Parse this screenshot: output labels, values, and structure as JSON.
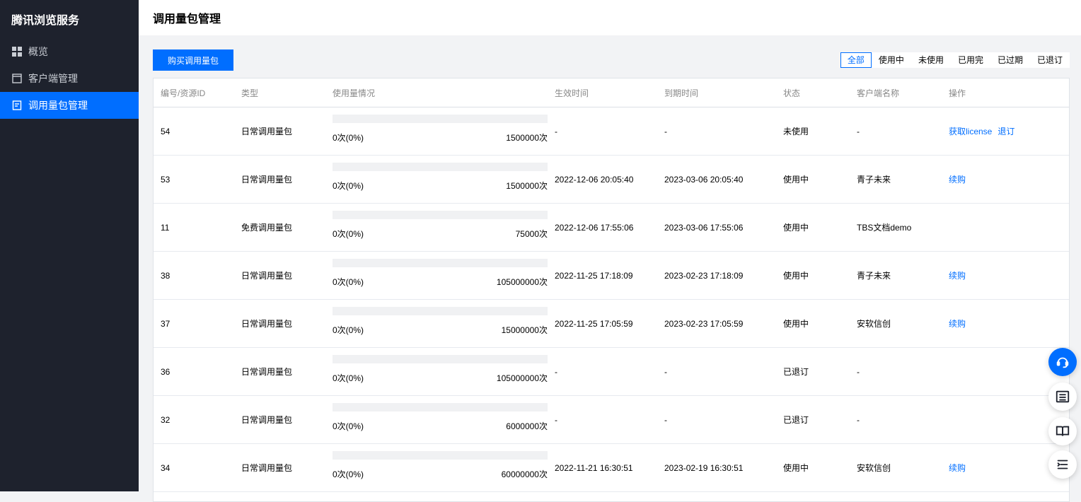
{
  "brand": "腾讯浏览服务",
  "sidebar": {
    "items": [
      {
        "label": "概览",
        "icon": "grid-icon"
      },
      {
        "label": "客户端管理",
        "icon": "window-icon"
      },
      {
        "label": "调用量包管理",
        "icon": "document-icon",
        "active": true
      }
    ]
  },
  "header": {
    "title": "调用量包管理"
  },
  "toolbar": {
    "buy_label": "购买调用量包",
    "filters": [
      "全部",
      "使用中",
      "未使用",
      "已用完",
      "已过期",
      "已退订"
    ],
    "active_filter": "全部"
  },
  "table": {
    "columns": [
      "编号/资源ID",
      "类型",
      "使用量情况",
      "生效时间",
      "到期时间",
      "状态",
      "客户端名称",
      "操作"
    ],
    "rows": [
      {
        "id": "54",
        "type": "日常调用量包",
        "used": "0次(0%)",
        "used_fraction": 0,
        "total": "1500000次",
        "start": "-",
        "end": "-",
        "status": "未使用",
        "client": "-",
        "ops": [
          "获取license",
          "退订"
        ]
      },
      {
        "id": "53",
        "type": "日常调用量包",
        "used": "0次(0%)",
        "used_fraction": 0,
        "total": "1500000次",
        "start": "2022-12-06 20:05:40",
        "end": "2023-03-06 20:05:40",
        "status": "使用中",
        "client": "青子未来",
        "ops": [
          "续购"
        ]
      },
      {
        "id": "11",
        "type": "免费调用量包",
        "used": "0次(0%)",
        "used_fraction": 0,
        "total": "75000次",
        "start": "2022-12-06 17:55:06",
        "end": "2023-03-06 17:55:06",
        "status": "使用中",
        "client": "TBS文档demo",
        "ops": []
      },
      {
        "id": "38",
        "type": "日常调用量包",
        "used": "0次(0%)",
        "used_fraction": 0,
        "total": "105000000次",
        "start": "2022-11-25 17:18:09",
        "end": "2023-02-23 17:18:09",
        "status": "使用中",
        "client": "青子未来",
        "ops": [
          "续购"
        ]
      },
      {
        "id": "37",
        "type": "日常调用量包",
        "used": "0次(0%)",
        "used_fraction": 0,
        "total": "15000000次",
        "start": "2022-11-25 17:05:59",
        "end": "2023-02-23 17:05:59",
        "status": "使用中",
        "client": "安软信创",
        "ops": [
          "续购"
        ]
      },
      {
        "id": "36",
        "type": "日常调用量包",
        "used": "0次(0%)",
        "used_fraction": 0,
        "total": "105000000次",
        "start": "-",
        "end": "-",
        "status": "已退订",
        "client": "-",
        "ops": []
      },
      {
        "id": "32",
        "type": "日常调用量包",
        "used": "0次(0%)",
        "used_fraction": 0,
        "total": "6000000次",
        "start": "-",
        "end": "-",
        "status": "已退订",
        "client": "-",
        "ops": []
      },
      {
        "id": "34",
        "type": "日常调用量包",
        "used": "0次(0%)",
        "used_fraction": 0,
        "total": "60000000次",
        "start": "2022-11-21 16:30:51",
        "end": "2023-02-19 16:30:51",
        "status": "使用中",
        "client": "安软信创",
        "ops": [
          "续购"
        ]
      }
    ]
  },
  "float_buttons": [
    "customer-service-icon",
    "list-icon",
    "book-icon",
    "outline-icon"
  ],
  "colors": {
    "accent": "#006eff",
    "sidebar_bg": "#1e222d"
  }
}
